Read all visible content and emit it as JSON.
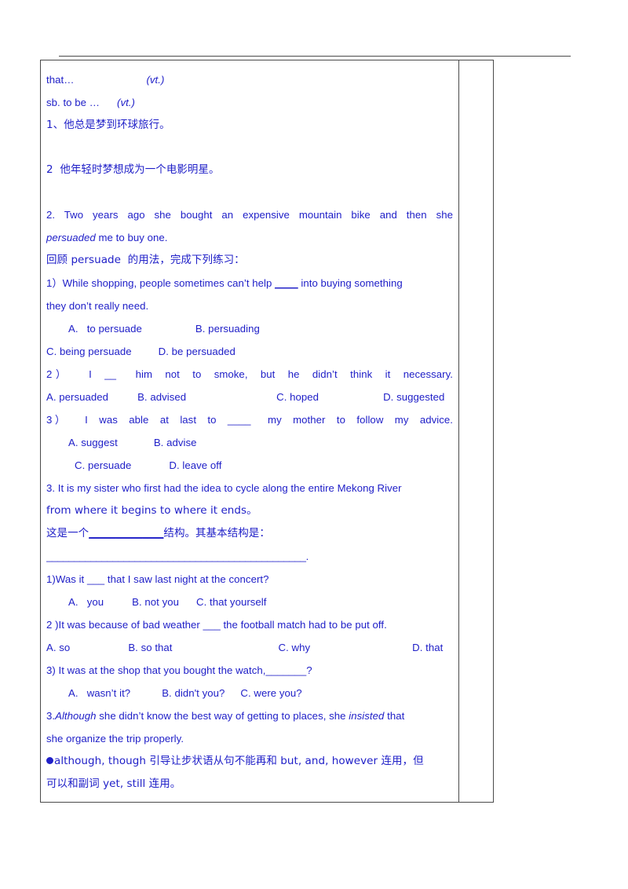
{
  "page": {
    "background": "#ffffff",
    "text_color": "#2020c8",
    "border_color": "#4a4a4a"
  },
  "table": {
    "columns": [
      "main-content",
      "side-note"
    ],
    "side_note_text": ""
  },
  "content": {
    "line_that": "that…",
    "line_that_pos": "(vt.)",
    "line_sbtobe": "sb. to be …",
    "line_sbtobe_pos": "(vt.)",
    "cn_1": "1、他总是梦到环球旅行。",
    "cn_2": "2  他年轻时梦想成为一个电影明星。",
    "q2_sentence_part1": "2. Two years ago she bought an expensive mountain bike and then she",
    "q2_sentence_italic": "persuaded",
    "q2_sentence_part2": " me to buy one.",
    "cn_review": "回顾 persuade  的用法，完成下列练习：",
    "q1_stem_a": "1）While shopping, people sometimes can’t help ",
    "q1_stem_blank": "____",
    "q1_stem_b": " into buying something",
    "q1_stem_c": "they don’t really need.",
    "q1_optA": "A.   to persuade",
    "q1_optB": "B. persuading",
    "q1_optC": "C. being persuade",
    "q1_optD": "D. be persuaded",
    "q2_stem": "2）   I  __   him  not  to  smoke,  but  he  didn’t  think  it  necessary.",
    "q2_optA": "A. persuaded",
    "q2_optB": "B. advised",
    "q2_optC": "C. hoped",
    "q2_optD": "D. suggested",
    "q3_stem": "3）   I  was  able  at  last  to  ____   my  mother  to  follow  my  advice.",
    "q3_optA": "A. suggest",
    "q3_optB": "B. advise",
    "q3_optC": "C. persuade",
    "q3_optD": "D. leave off",
    "q3_sentence_a": "3. It is my sister who first had the idea to cycle along the entire Mekong River",
    "q3_sentence_b": "from where it begins to where it ends。",
    "cn_structure_a": "这是一个",
    "cn_structure_blank": "______________",
    "cn_structure_b": "结构。其基本结构是：",
    "cn_structure_rule": "_______________________________________________.",
    "s1_stem": "1)Was it ___ that I saw last night at the concert?",
    "s1_optA": "A.   you",
    "s1_optB": "B. not you",
    "s1_optC": "C. that yourself",
    "s2_stem": "2 )It was because of bad weather ___ the football match had to be put off.",
    "s2_optA": "A. so",
    "s2_optB": "B. so that",
    "s2_optC": "C. why",
    "s2_optD": "D. that",
    "s3_stem": "3) It was at the shop that you bought the watch,_______?",
    "s3_optA": "A.   wasn’t it?",
    "s3_optB": "B. didn't you?",
    "s3_optC": "C. were you?",
    "q4_num": "3.",
    "q4_italic1": "Although",
    "q4_mid": " she didn’t know the best way of getting to places, she ",
    "q4_italic2": "insisted",
    "q4_end": " that",
    "q4_line2": "she organize the trip properly.",
    "note_line1": "although, though 引导让步状语从句不能再和 but, and, however 连用，但",
    "note_line2": "可以和副词 yet, still 连用。"
  }
}
